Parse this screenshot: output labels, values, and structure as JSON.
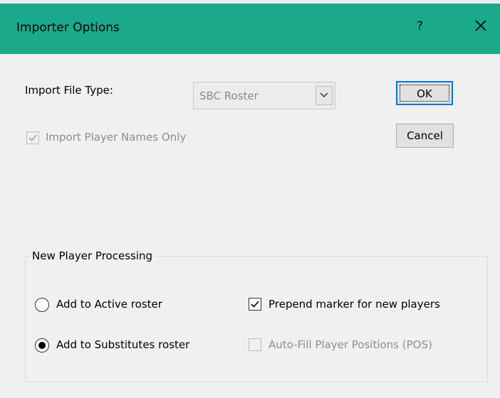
{
  "window": {
    "title": "Importer Options",
    "help_label": "?",
    "accent_color": "#1ba98b"
  },
  "form": {
    "file_type_label": "Import File Type:",
    "file_type_value": "SBC Roster",
    "import_names_only_label": "Import Player Names Only",
    "import_names_only_checked": true,
    "import_names_only_enabled": false
  },
  "buttons": {
    "ok_label": "OK",
    "cancel_label": "Cancel"
  },
  "new_player_group": {
    "title": "New Player Processing",
    "radio_active_label": "Add to Active roster",
    "radio_active_selected": false,
    "radio_subs_label": "Add to Substitutes roster",
    "radio_subs_selected": true,
    "prepend_marker_label": "Prepend marker for new players",
    "prepend_marker_checked": true,
    "autofill_label": "Auto-Fill Player Positions (POS)",
    "autofill_checked": false,
    "autofill_enabled": false
  },
  "icons": {
    "close": "close-icon",
    "dropdown": "chevron-down-icon",
    "check": "check-icon"
  }
}
